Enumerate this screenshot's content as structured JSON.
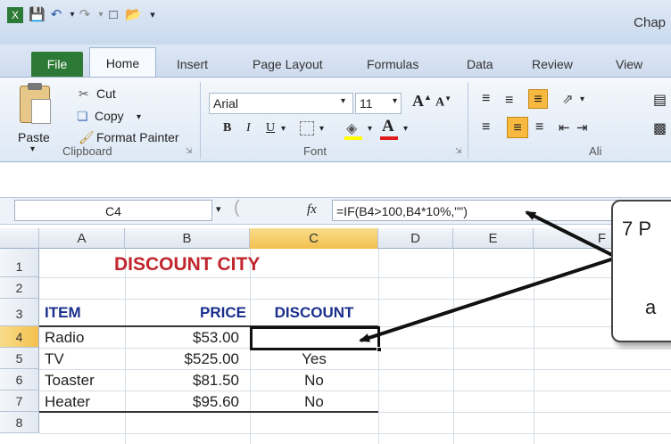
{
  "window": {
    "title": "Chap"
  },
  "quick_access": {
    "icons": [
      "excel-logo-icon",
      "save-icon",
      "undo-icon",
      "redo-icon",
      "new-icon",
      "open-icon",
      "customize-icon"
    ]
  },
  "tabs": [
    "File",
    "Home",
    "Insert",
    "Page Layout",
    "Formulas",
    "Data",
    "Review",
    "View"
  ],
  "ribbon": {
    "clipboard": {
      "paste": "Paste",
      "cut": "Cut",
      "copy": "Copy",
      "format_painter": "Format Painter",
      "label": "Clipboard"
    },
    "font": {
      "name": "Arial",
      "size": "11",
      "bold": "B",
      "italic": "I",
      "underline": "U",
      "grow": "A",
      "shrink": "A",
      "font_color": "A",
      "label": "Font"
    },
    "alignment": {
      "label": "Ali"
    }
  },
  "formula_bar": {
    "name_box": "C4",
    "fx": "fx",
    "formula": "=IF(B4>100,B4*10%,\"\")"
  },
  "columns": [
    "A",
    "B",
    "C",
    "D",
    "E",
    "F"
  ],
  "rows": [
    "1",
    "2",
    "3",
    "4",
    "5",
    "6",
    "7",
    "8"
  ],
  "sheet": {
    "title": "DISCOUNT CITY",
    "headers": {
      "item": "ITEM",
      "price": "PRICE",
      "discount": "DISCOUNT"
    },
    "data": [
      {
        "item": "Radio",
        "price": "$53.00",
        "discount": ""
      },
      {
        "item": "TV",
        "price": "$525.00",
        "discount": "Yes"
      },
      {
        "item": "Toaster",
        "price": "$81.50",
        "discount": "No"
      },
      {
        "item": "Heater",
        "price": "$95.60",
        "discount": "No"
      }
    ]
  },
  "callout": {
    "line1": "7 P",
    "line2": "a"
  },
  "colors": {
    "title_red": "#c0262d",
    "header_blue": "#1a2f8c",
    "file_green": "#2d7a36",
    "highlight_orange": "#f7b940",
    "selected_col": "#f7c85a"
  }
}
